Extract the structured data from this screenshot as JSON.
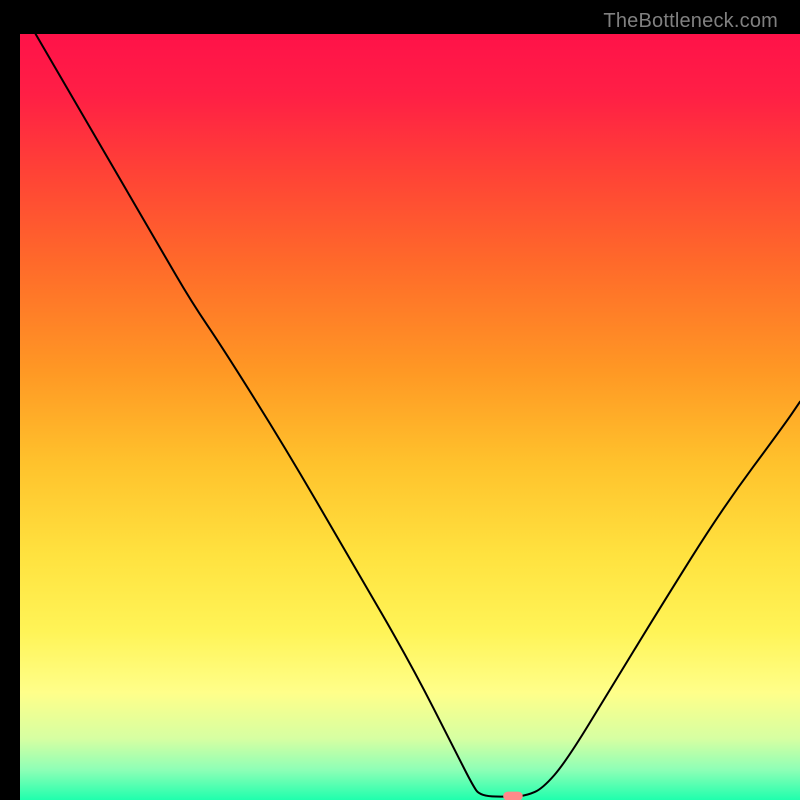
{
  "attribution": "TheBottleneck.com",
  "chart_data": {
    "type": "line",
    "title": "",
    "xlabel": "",
    "ylabel": "",
    "xlim": [
      0,
      100
    ],
    "ylim": [
      0,
      100
    ],
    "background_gradient": {
      "stops": [
        {
          "offset": 0.0,
          "color": "#ff1249"
        },
        {
          "offset": 0.08,
          "color": "#ff1f45"
        },
        {
          "offset": 0.18,
          "color": "#ff4236"
        },
        {
          "offset": 0.3,
          "color": "#ff6a2a"
        },
        {
          "offset": 0.44,
          "color": "#ff9824"
        },
        {
          "offset": 0.56,
          "color": "#ffc22c"
        },
        {
          "offset": 0.68,
          "color": "#ffe23f"
        },
        {
          "offset": 0.78,
          "color": "#fff457"
        },
        {
          "offset": 0.86,
          "color": "#ffff8a"
        },
        {
          "offset": 0.92,
          "color": "#d6ffa2"
        },
        {
          "offset": 0.96,
          "color": "#8fffb6"
        },
        {
          "offset": 1.0,
          "color": "#1fffad"
        }
      ]
    },
    "curve": {
      "stroke": "#000000",
      "stroke_width": 2,
      "points": [
        {
          "x": 2,
          "y": 100
        },
        {
          "x": 10,
          "y": 86
        },
        {
          "x": 18,
          "y": 72
        },
        {
          "x": 22,
          "y": 65
        },
        {
          "x": 26,
          "y": 59
        },
        {
          "x": 34,
          "y": 46
        },
        {
          "x": 42,
          "y": 32
        },
        {
          "x": 50,
          "y": 18
        },
        {
          "x": 56,
          "y": 6
        },
        {
          "x": 58,
          "y": 2
        },
        {
          "x": 59,
          "y": 0.5
        },
        {
          "x": 63,
          "y": 0.4
        },
        {
          "x": 65,
          "y": 0.6
        },
        {
          "x": 67,
          "y": 1.5
        },
        {
          "x": 70,
          "y": 5
        },
        {
          "x": 76,
          "y": 15
        },
        {
          "x": 82,
          "y": 25
        },
        {
          "x": 90,
          "y": 38
        },
        {
          "x": 98,
          "y": 49
        },
        {
          "x": 100,
          "y": 52
        }
      ]
    },
    "marker": {
      "x": 63.2,
      "y": 0.5,
      "color": "#ff8a8a",
      "width": 2.5,
      "height": 1.2
    }
  }
}
